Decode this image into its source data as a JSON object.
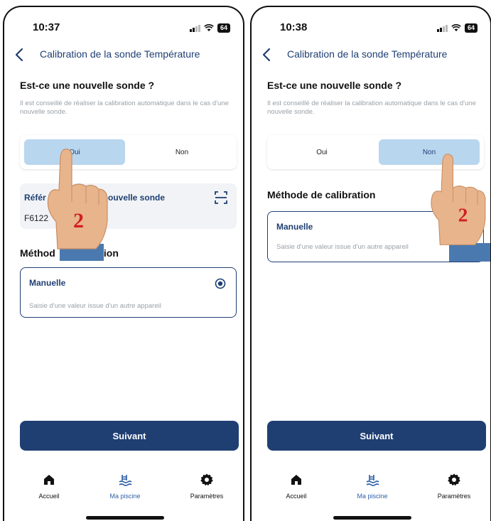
{
  "screens": [
    {
      "status_time": "10:37",
      "battery": "64",
      "nav_title": "Calibration de la sonde Température",
      "question_title": "Est-ce une nouvelle sonde ?",
      "question_desc": "Il est conseillé de réaliser la calibration automatique dans le cas d'une nouvelle sonde.",
      "option_yes": "Oui",
      "option_no": "Non",
      "selected": "Oui",
      "ref_label_start": "Référ",
      "ref_label_end": "ouvelle sonde",
      "ref_value": "F6122",
      "method_title_start": "Méthod",
      "method_title_end": "ration",
      "method_name": "Manuelle",
      "method_desc": "Saisie d'une valeur issue d'un autre appareil",
      "next_button": "Suivant",
      "step_number": "2"
    },
    {
      "status_time": "10:38",
      "battery": "64",
      "nav_title": "Calibration de la sonde Température",
      "question_title": "Est-ce une nouvelle sonde ?",
      "question_desc": "Il est conseillé de réaliser la calibration automatique dans le cas d'une nouvelle sonde.",
      "option_yes": "Oui",
      "option_no": "Non",
      "selected": "Non",
      "method_title": "Méthode de calibration",
      "method_name": "Manuelle",
      "method_desc": "Saisie d'une valeur issue d'un autre appareil",
      "next_button": "Suivant",
      "step_number": "2"
    }
  ],
  "tabs": [
    "Accueil",
    "Ma piscine",
    "Paramètres"
  ],
  "active_tab": "Ma piscine",
  "icons": {
    "back": "chevron-left-icon",
    "scan": "scan-icon",
    "radio": "radio-selected-icon",
    "home": "home-icon",
    "pool": "pool-icon",
    "settings": "gear-icon"
  },
  "colors": {
    "primary": "#1f3f73",
    "selected_option": "#b9d6ef",
    "muted_text": "#9aa0a6",
    "active_tab": "#2c5ea8"
  }
}
